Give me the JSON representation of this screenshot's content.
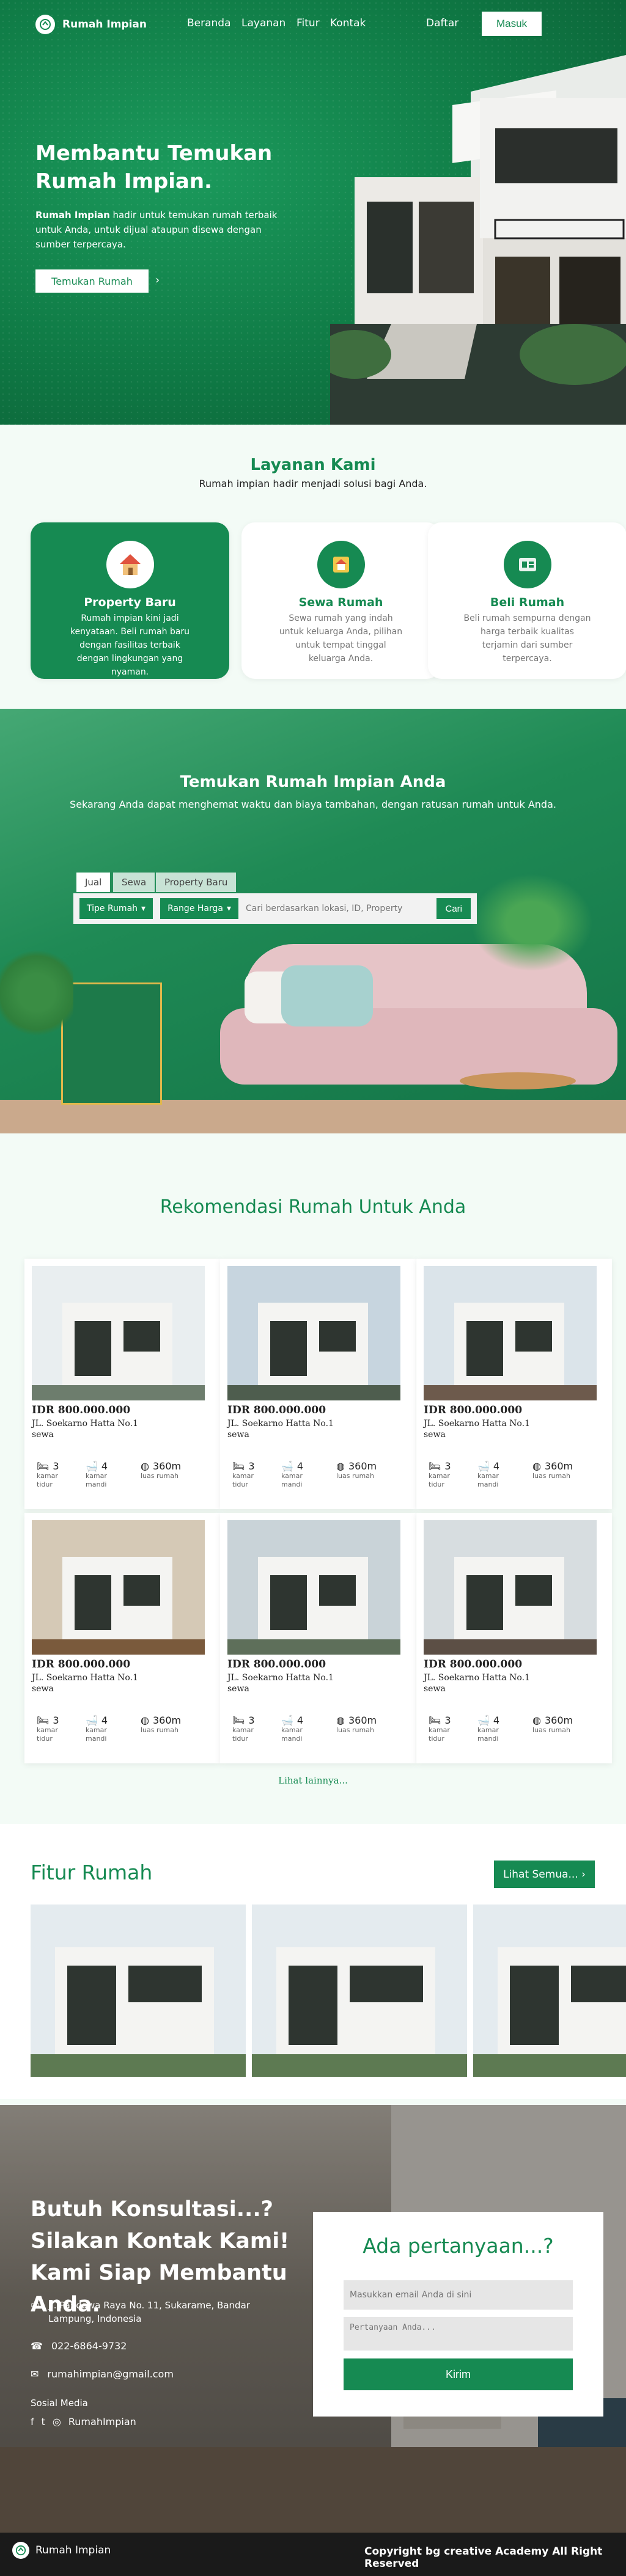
{
  "nav": {
    "brand": "Rumah Impian",
    "links": [
      "Beranda",
      "Layanan",
      "Fitur",
      "Kontak"
    ],
    "daftar": "Daftar",
    "masuk": "Masuk"
  },
  "hero": {
    "title": "Membantu Temukan Rumah Impian.",
    "desc_brand": "Rumah Impian",
    "desc_rest": " hadir untuk temukan rumah terbaik untuk Anda, untuk dijual ataupun disewa dengan sumber terpercaya.",
    "cta": "Temukan Rumah",
    "arrow": "›"
  },
  "services": {
    "title": "Layanan Kami",
    "subtitle": "Rumah impian hadir menjadi solusi bagi Anda.",
    "cards": [
      {
        "title": "Property Baru",
        "desc": "Rumah impian kini jadi kenyataan. Beli rumah baru dengan fasilitas terbaik dengan lingkungan yang nyaman."
      },
      {
        "title": "Sewa Rumah",
        "desc": "Sewa rumah yang indah untuk keluarga Anda, pilihan untuk tempat tinggal keluarga Anda."
      },
      {
        "title": "Beli Rumah",
        "desc": "Beli rumah sempurna dengan harga terbaik kualitas terjamin dari sumber terpercaya."
      }
    ]
  },
  "find": {
    "title": "Temukan Rumah Impian Anda",
    "subtitle": "Sekarang Anda dapat menghemat waktu dan biaya tambahan, dengan ratusan rumah untuk Anda.",
    "tabs": [
      "Jual",
      "Sewa",
      "Property Baru"
    ],
    "type_select": "Tipe Rumah",
    "price_select": "Range Harga",
    "search_placeholder": "Cari berdasarkan lokasi, ID, Property",
    "search_button": "Cari"
  },
  "recommend": {
    "title": "Rekomendasi Rumah Untuk Anda",
    "houses": [
      {
        "price": "IDR 800.000.000",
        "address": "JL. Soekarno Hatta No.1",
        "type": "sewa",
        "beds": "3",
        "bed_label": "kamar tidur",
        "baths": "4",
        "bath_label": "kamar mandi",
        "area": "360m",
        "area_label": "luas rumah"
      },
      {
        "price": "IDR 800.000.000",
        "address": "JL. Soekarno Hatta No.1",
        "type": "sewa",
        "beds": "3",
        "bed_label": "kamar tidur",
        "baths": "4",
        "bath_label": "kamar mandi",
        "area": "360m",
        "area_label": "luas rumah"
      },
      {
        "price": "IDR 800.000.000",
        "address": "JL. Soekarno Hatta No.1",
        "type": "sewa",
        "beds": "3",
        "bed_label": "kamar tidur",
        "baths": "4",
        "bath_label": "kamar mandi",
        "area": "360m",
        "area_label": "luas rumah"
      },
      {
        "price": "IDR 800.000.000",
        "address": "JL. Soekarno Hatta No.1",
        "type": "sewa",
        "beds": "3",
        "bed_label": "kamar tidur",
        "baths": "4",
        "bath_label": "kamar mandi",
        "area": "360m",
        "area_label": "luas rumah"
      },
      {
        "price": "IDR 800.000.000",
        "address": "JL. Soekarno Hatta No.1",
        "type": "sewa",
        "beds": "3",
        "bed_label": "kamar tidur",
        "baths": "4",
        "bath_label": "kamar mandi",
        "area": "360m",
        "area_label": "luas rumah"
      },
      {
        "price": "IDR 800.000.000",
        "address": "JL. Soekarno Hatta No.1",
        "type": "sewa",
        "beds": "3",
        "bed_label": "kamar tidur",
        "baths": "4",
        "bath_label": "kamar mandi",
        "area": "360m",
        "area_label": "luas rumah"
      }
    ],
    "more": "Lihat lainnya..."
  },
  "fitur": {
    "title": "Fitur Rumah",
    "button": "Lihat Semua... ›"
  },
  "contact": {
    "title": "Butuh Konsultasi...? Silakan Kontak Kami! Kami Siap Membantu Anda.",
    "address": "Jl. Pandawa Raya No. 11, Sukarame, Bandar Lampung, Indonesia",
    "phone": "022-6864-9732",
    "email": "rumahimpian@gmail.com",
    "social_label": "Sosial Media",
    "social_handle": "RumahImpian",
    "form_title": "Ada pertanyaan...?",
    "email_placeholder": "Masukkan email Anda di sini",
    "question_placeholder": "Pertanyaan Anda...",
    "submit": "Kirim"
  },
  "footer": {
    "brand": "Rumah Impian",
    "copyright": "Copyright bg creative Academy All Right Reserved"
  },
  "colors": {
    "accent": "#168a52",
    "footer": "#1a1a1a"
  },
  "icons": [
    "logo-house-icon",
    "arrow-right-icon",
    "house-icon",
    "rent-icon",
    "buy-icon",
    "bed-icon",
    "bath-icon",
    "globe-icon",
    "location-icon",
    "phone-icon",
    "mail-icon",
    "facebook-icon",
    "twitter-icon",
    "instagram-icon"
  ]
}
